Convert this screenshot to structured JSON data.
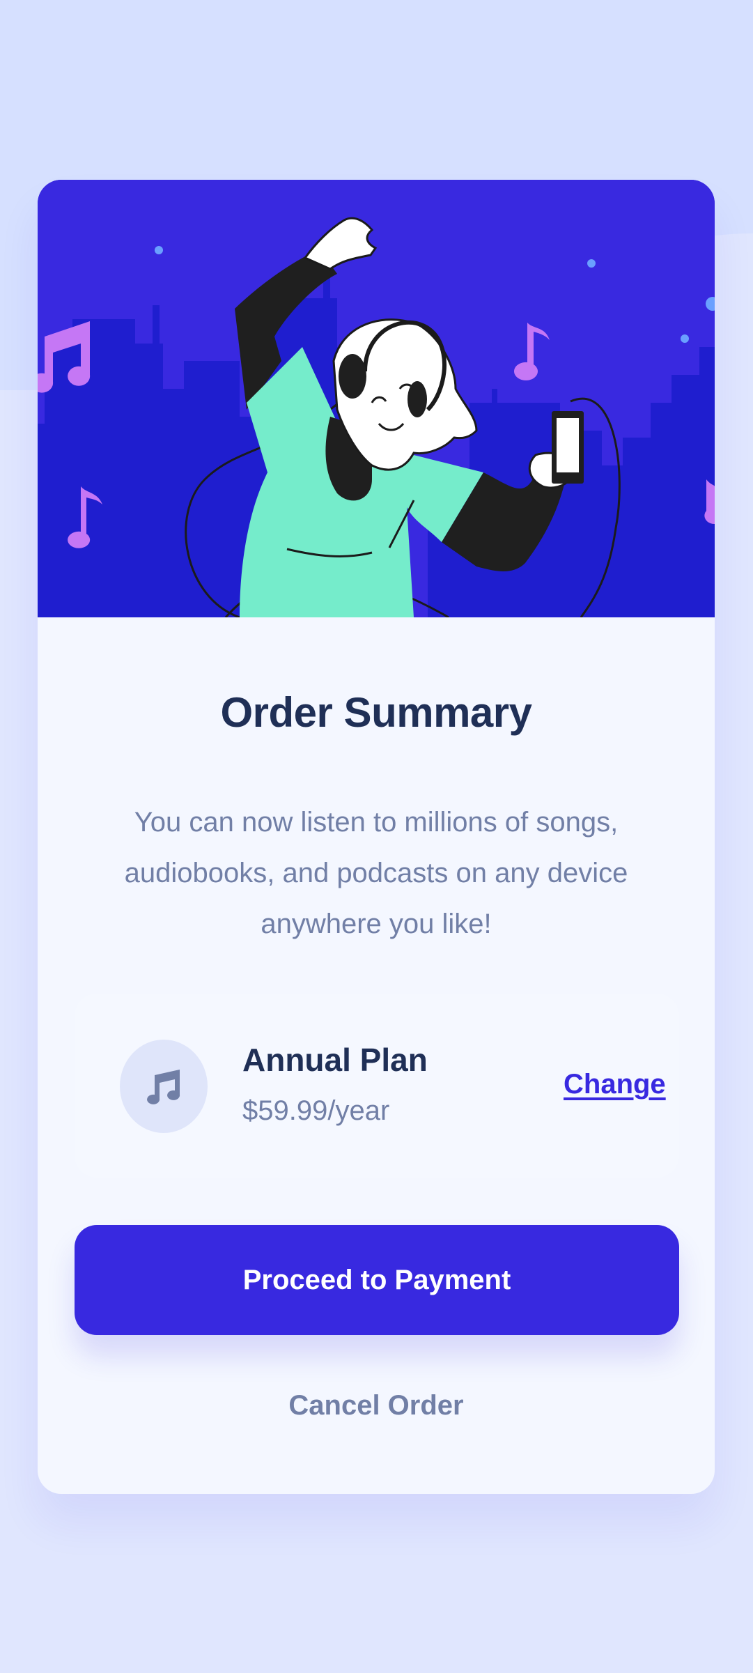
{
  "page": {
    "background_color": "#e0e6fe",
    "pattern_color": "#d6e0ff"
  },
  "hero": {
    "illustration": "woman-dancing-with-headphones",
    "background_color": "#3929e0",
    "building_color": "#1f1ecf",
    "accent_note_color": "#c577f5",
    "shirt_color": "#75eccb"
  },
  "summary": {
    "title": "Order Summary",
    "description": "You can now listen to millions of songs, audiobooks, and podcasts on any device anywhere you like!"
  },
  "plan": {
    "icon": "music-note-icon",
    "name": "Annual Plan",
    "price": "$59.99/year",
    "change_label": "Change"
  },
  "actions": {
    "proceed_label": "Proceed to Payment",
    "cancel_label": "Cancel Order"
  },
  "colors": {
    "primary": "#3829e0",
    "dark_text": "#1f2f56",
    "muted_text": "#717fa6"
  }
}
